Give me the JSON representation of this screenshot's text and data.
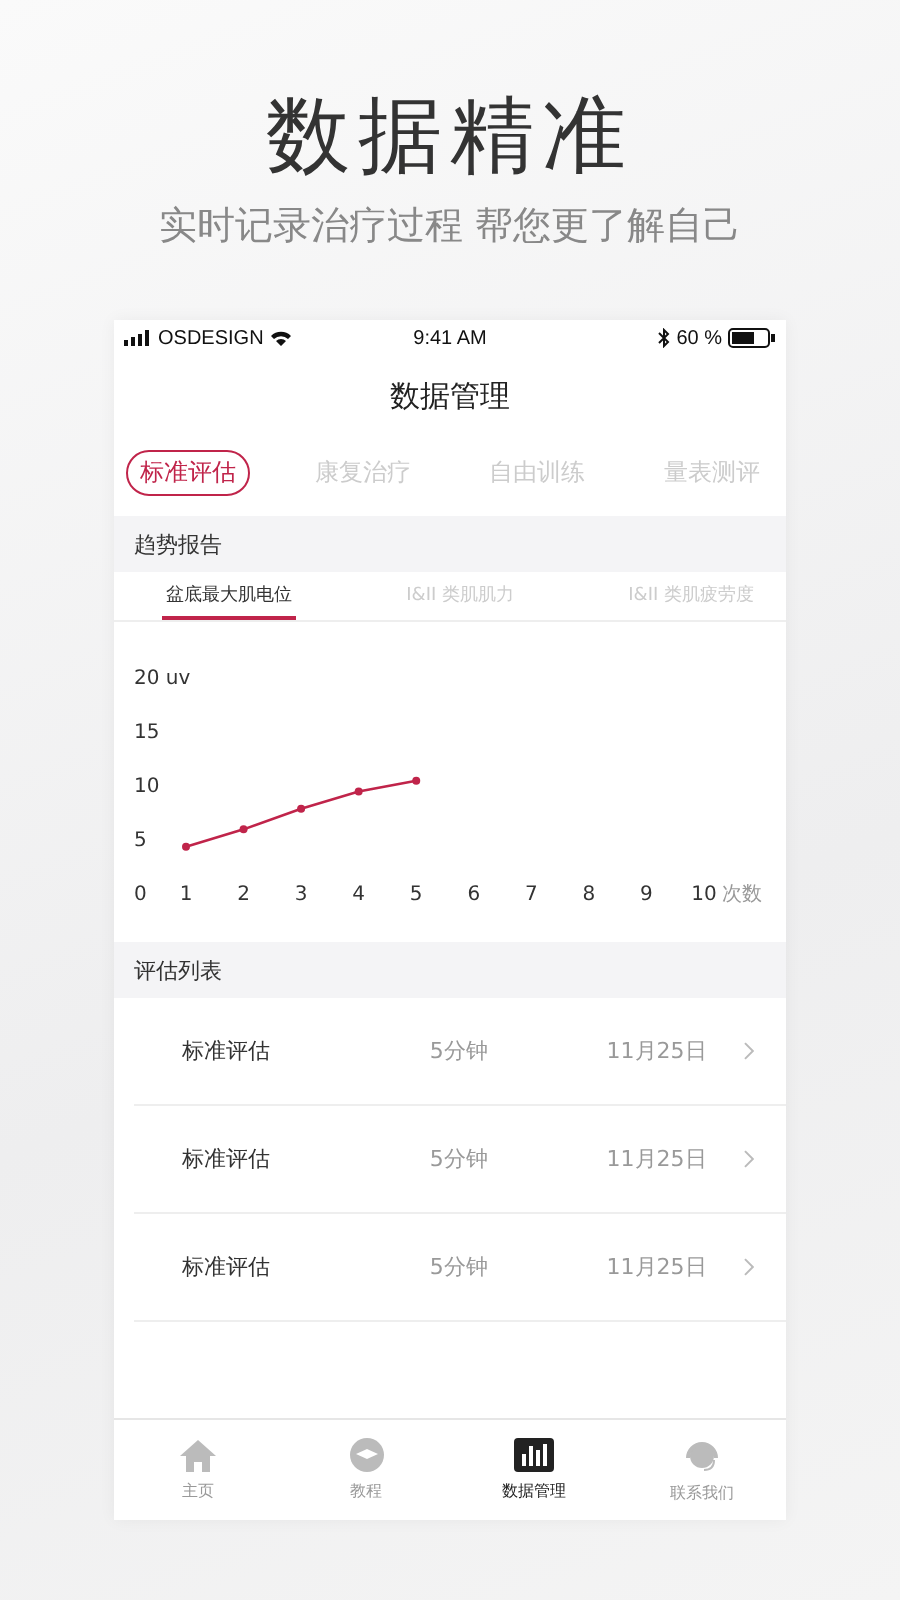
{
  "headline": "数据精准",
  "subheadline": "实时记录治疗过程  帮您更了解自己",
  "status_bar": {
    "carrier": "OSDESIGN",
    "time": "9:41 AM",
    "battery": "60 %"
  },
  "title": "数据管理",
  "tabs": [
    {
      "label": "标准评估",
      "selected": true
    },
    {
      "label": "康复治疗",
      "selected": false
    },
    {
      "label": "自由训练",
      "selected": false
    },
    {
      "label": "量表测评",
      "selected": false
    }
  ],
  "trend": {
    "heading": "趋势报告",
    "subtabs": [
      {
        "label": "盆底最大肌电位",
        "selected": true
      },
      {
        "label": "I&II 类肌肌力",
        "selected": false
      },
      {
        "label": "I&II 类肌疲劳度",
        "selected": false
      }
    ],
    "chart_data": {
      "type": "line",
      "xlabel": "次数",
      "x": [
        1,
        2,
        3,
        4,
        5
      ],
      "series": [
        {
          "color": "#c0244a",
          "marker": "circle",
          "values": [
            4.2,
            5.8,
            7.7,
            9.3,
            10.3
          ]
        }
      ],
      "xlim": [
        1,
        10
      ],
      "ylim": [
        0,
        20
      ],
      "yticks": [
        0,
        5,
        10,
        15,
        {
          "value": 20,
          "label": "20 uv"
        }
      ],
      "xticks": [
        1,
        2,
        3,
        4,
        5,
        6,
        7,
        8,
        9,
        10
      ]
    }
  },
  "list": {
    "heading": "评估列表",
    "rows": [
      {
        "name": "标准评估",
        "duration": "5分钟",
        "date": "11月25日"
      },
      {
        "name": "标准评估",
        "duration": "5分钟",
        "date": "11月25日"
      },
      {
        "name": "标准评估",
        "duration": "5分钟",
        "date": "11月25日"
      }
    ]
  },
  "nav": [
    {
      "label": "主页",
      "kind": "home",
      "selected": false
    },
    {
      "label": "教程",
      "kind": "tutorial",
      "selected": false
    },
    {
      "label": "数据管理",
      "kind": "data",
      "selected": true
    },
    {
      "label": "联系我们",
      "kind": "contact",
      "selected": false
    }
  ]
}
